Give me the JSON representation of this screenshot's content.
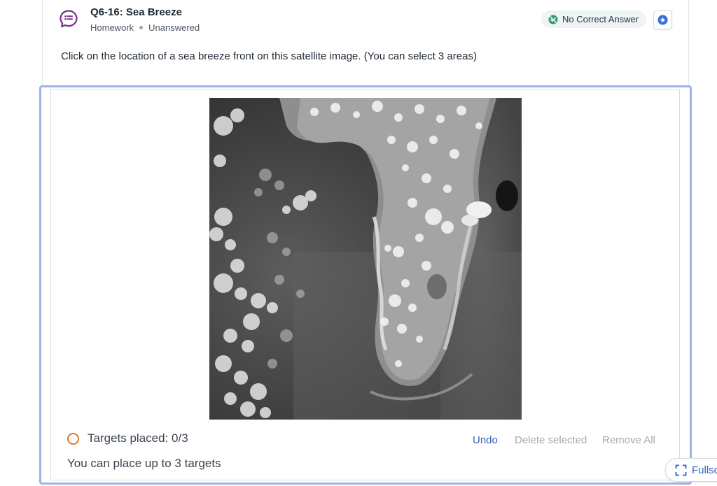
{
  "question": {
    "title": "Q6-16: Sea Breeze",
    "type": "Homework",
    "status": "Unanswered",
    "prompt": "Click on the location of a sea breeze front on this satellite image. (You can select 3 areas)"
  },
  "badge": {
    "label": "No Correct Answer",
    "icon": "no-answer-icon",
    "color": "#2e9e6a"
  },
  "star_icon": "star-badge-icon",
  "hotspot": {
    "image_icon": "satellite-image",
    "targets_label": "Targets placed: 0/3",
    "placed": 0,
    "max": 3,
    "hint": "You can place up to 3 targets",
    "undo_label": "Undo",
    "delete_label": "Delete selected",
    "remove_all_label": "Remove All"
  },
  "fullscreen_label": "Fullsc",
  "colors": {
    "accent": "#2d5fc4",
    "question_icon": "#7a2e8e",
    "focus_border": "#9bb4ec",
    "target_ring": "#e0752b"
  }
}
